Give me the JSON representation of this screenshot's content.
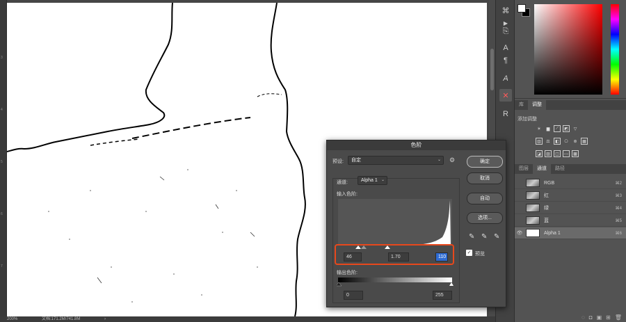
{
  "status_bar": {
    "zoom": "200%",
    "doc_size": "文档:171.2M/741.8M",
    "arrow": "›"
  },
  "ruler": {
    "marks": [
      "3",
      "4",
      "5",
      "6",
      "7",
      "8"
    ]
  },
  "tools": [
    {
      "name": "history-brush-icon",
      "glyph": "⌘"
    },
    {
      "name": "play-icon",
      "glyph": "▶"
    },
    {
      "name": "clone-icon",
      "glyph": "⎘"
    },
    {
      "name": "character-icon",
      "glyph": "A"
    },
    {
      "name": "paragraph-icon",
      "glyph": "¶"
    },
    {
      "name": "text-a-icon",
      "glyph": "A"
    },
    {
      "name": "tools-crossed-icon",
      "glyph": "✕"
    },
    {
      "name": "glyph-r-icon",
      "glyph": "R"
    }
  ],
  "color_panel": {
    "fg": "#ffffff",
    "bg": "#000000"
  },
  "adjust_panel": {
    "tabs": [
      "库",
      "调整"
    ],
    "active_tab": "调整",
    "title": "添加调整"
  },
  "layers_panel": {
    "tabs": [
      "图层",
      "通道",
      "路径"
    ],
    "active_tab": "通道",
    "channels": [
      {
        "name": "RGB",
        "key": "⌘2",
        "eye": "",
        "thumb": "color"
      },
      {
        "name": "红",
        "key": "⌘3",
        "eye": "",
        "thumb": "color"
      },
      {
        "name": "绿",
        "key": "⌘4",
        "eye": "",
        "thumb": "color"
      },
      {
        "name": "蓝",
        "key": "⌘5",
        "eye": "",
        "thumb": "color"
      },
      {
        "name": "Alpha 1",
        "key": "⌘6",
        "eye": "👁",
        "thumb": "white"
      }
    ],
    "footer_icons": [
      "◌",
      "◘",
      "▣",
      "⊞",
      "🗑"
    ]
  },
  "levels_dialog": {
    "title": "色阶",
    "preset_label": "预设:",
    "preset_value": "自定",
    "channel_label": "通道:",
    "channel_value": "Alpha 1",
    "input_label": "输入色阶:",
    "input_black": "46",
    "input_gamma": "1.70",
    "input_white": "110",
    "output_label": "输出色阶:",
    "output_black": "0",
    "output_white": "255",
    "ok": "确定",
    "cancel": "取消",
    "auto": "自动",
    "options": "选项...",
    "preview": "预览",
    "preview_checked": true,
    "accent": "#e8481c",
    "selection": "#2e6bd3"
  }
}
